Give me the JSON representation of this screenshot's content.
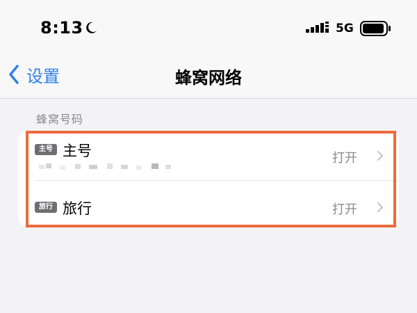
{
  "status_bar": {
    "time": "8:13",
    "carrier": "5G",
    "icons": [
      "moon-icon",
      "cellular-signal-icon",
      "battery-icon"
    ]
  },
  "nav": {
    "back_label": "设置",
    "title": "蜂窝网络",
    "back_icon": "chevron-left-icon"
  },
  "section": {
    "header": "蜂窝号码"
  },
  "lines": [
    {
      "badge": "主号",
      "label": "蜂窝号码主号",
      "label_text": "主号",
      "value": "打开"
    },
    {
      "badge": "旅行",
      "label_text": "旅行",
      "value": "打开"
    }
  ],
  "colors": {
    "accent": "#2f80e8",
    "highlight": "#ee6a3c",
    "background": "#f2f2f7",
    "secondary_text": "#8a8a8e"
  }
}
